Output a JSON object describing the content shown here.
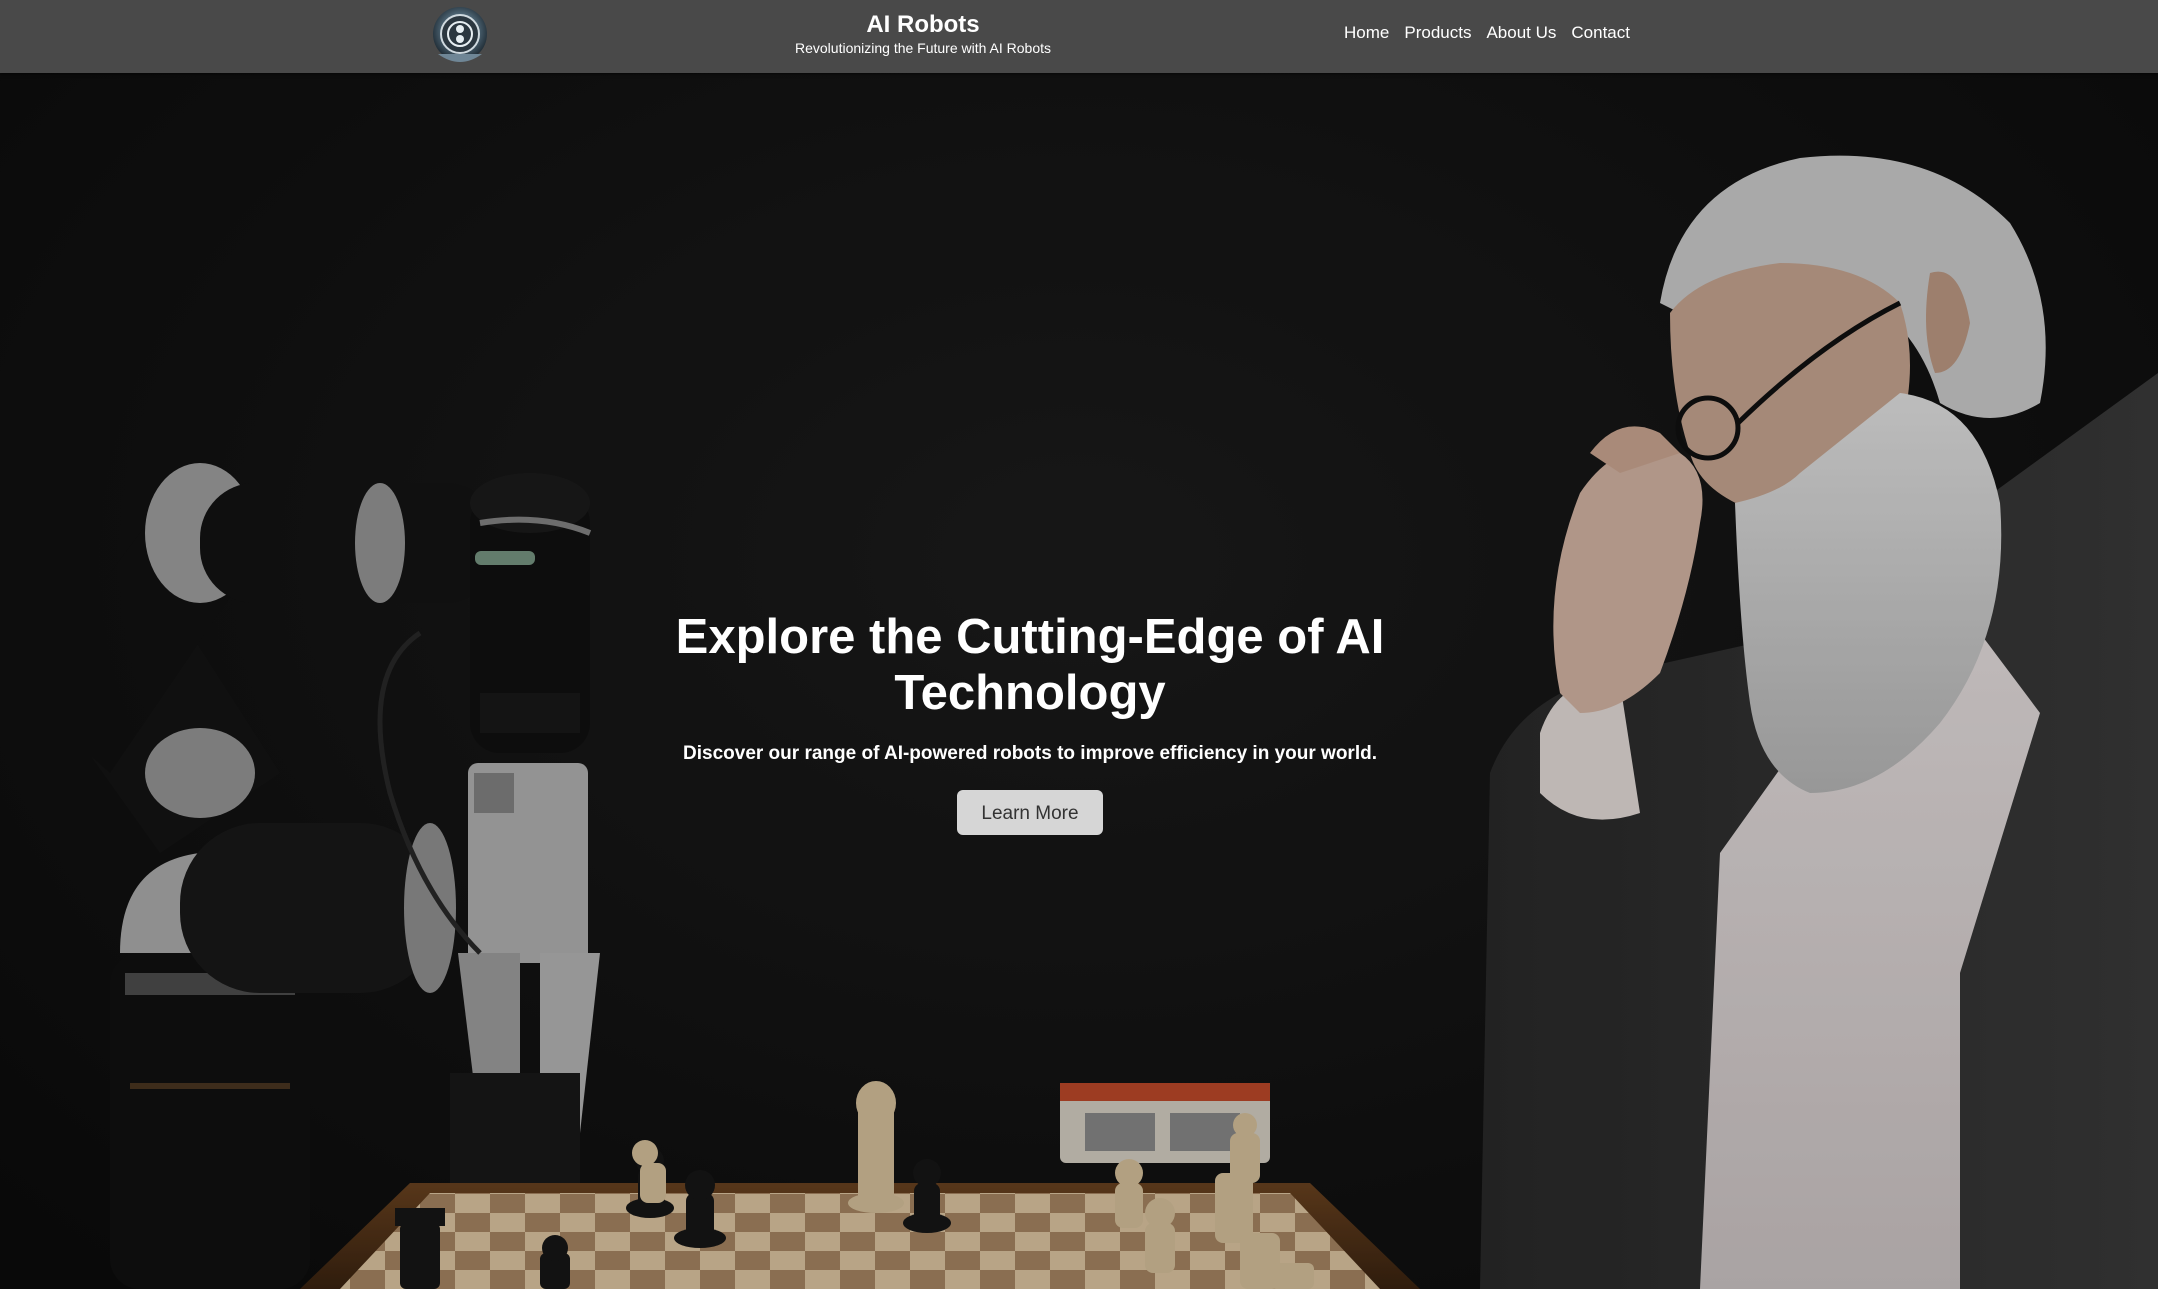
{
  "header": {
    "logo_icon": "robot-head-icon",
    "title": "AI Robots",
    "subtitle": "Revolutionizing the Future with AI Robots",
    "nav": [
      {
        "label": "Home"
      },
      {
        "label": "Products"
      },
      {
        "label": "About Us"
      },
      {
        "label": "Contact"
      }
    ]
  },
  "hero": {
    "title": "Explore the Cutting-Edge of AI Technology",
    "subtitle": "Discover our range of AI-powered robots to improve efficiency in your world.",
    "cta_label": "Learn More",
    "background_image": "robot-arm-vs-man-chess-photo"
  },
  "colors": {
    "header_bg": "#494949",
    "hero_bg": "#111111",
    "button_bg": "#d6d6d6",
    "button_text": "#333333"
  }
}
